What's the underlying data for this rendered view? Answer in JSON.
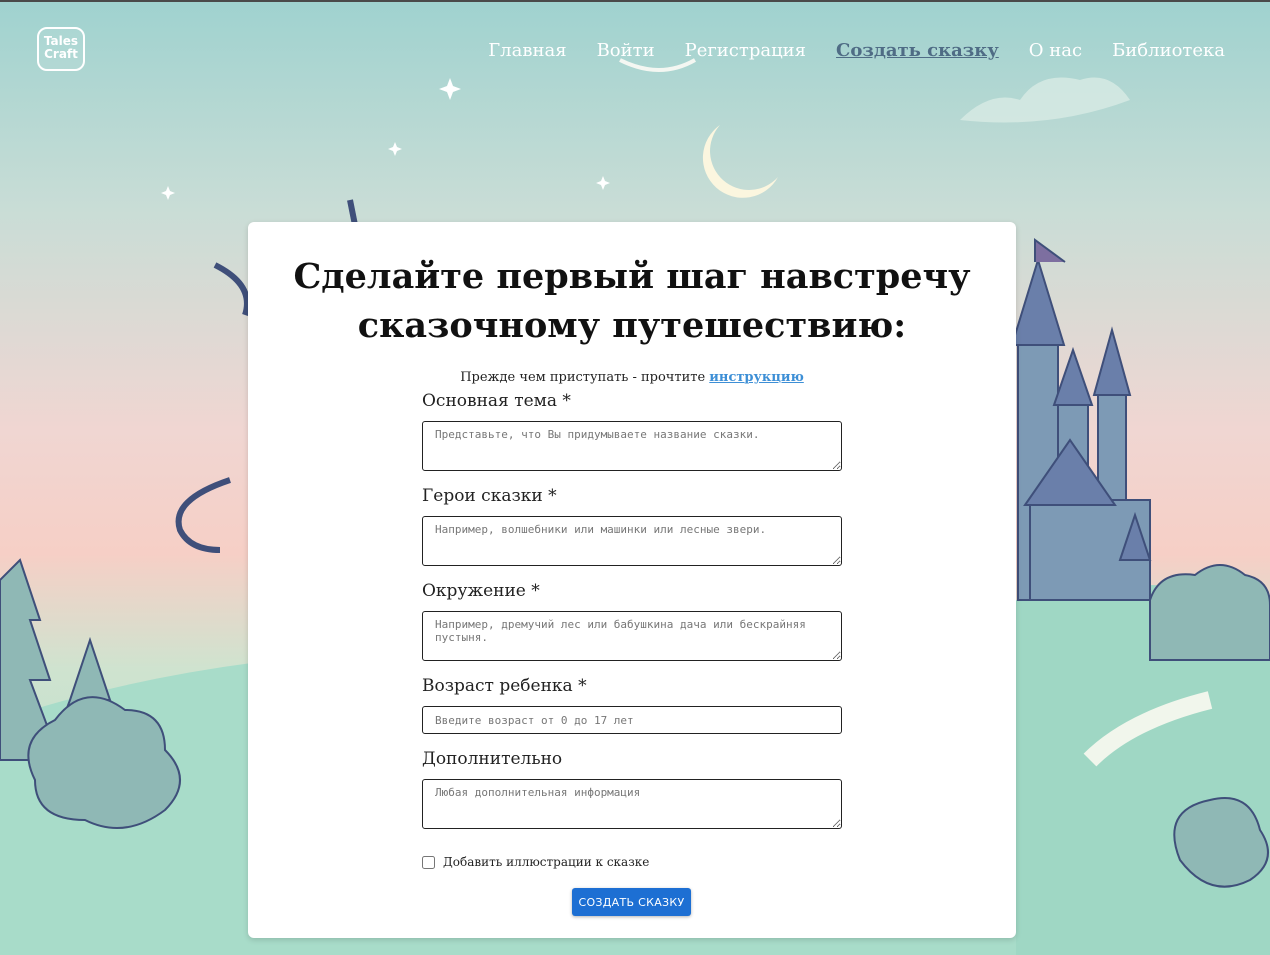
{
  "header": {
    "logo_text": "Tales Craft",
    "nav": [
      {
        "label": "Главная",
        "active": false
      },
      {
        "label": "Войти",
        "active": false
      },
      {
        "label": "Регистрация",
        "active": false
      },
      {
        "label": "Создать сказку",
        "active": true
      },
      {
        "label": "О нас",
        "active": false
      },
      {
        "label": "Библиотека",
        "active": false
      }
    ]
  },
  "card": {
    "title": "Сделайте первый шаг навстречу сказочному путешествию:",
    "hint_text": "Прежде чем приступать - прочтите ",
    "hint_link": "инструкцию"
  },
  "form": {
    "theme": {
      "label": "Основная тема *",
      "placeholder": "Представьте, что Вы придумываете название сказки."
    },
    "heroes": {
      "label": "Герои сказки *",
      "placeholder": "Например, волшебники или машинки или лесные звери."
    },
    "setting": {
      "label": "Окружение *",
      "placeholder": "Например, дремучий лес или бабушкина дача или бескрайняя пустыня."
    },
    "age": {
      "label": "Возраст ребенка *",
      "placeholder": "Введите возраст от 0 до 17 лет"
    },
    "extra": {
      "label": "Дополнительно",
      "placeholder": "Любая дополнительная информация"
    },
    "illustrations_label": "Добавить иллюстрации к сказке",
    "submit_label": "СОЗДАТЬ СКАЗКУ"
  },
  "colors": {
    "accent": "#1d6fd3",
    "link": "#3d8fd6",
    "nav_active": "#4f6c85"
  }
}
